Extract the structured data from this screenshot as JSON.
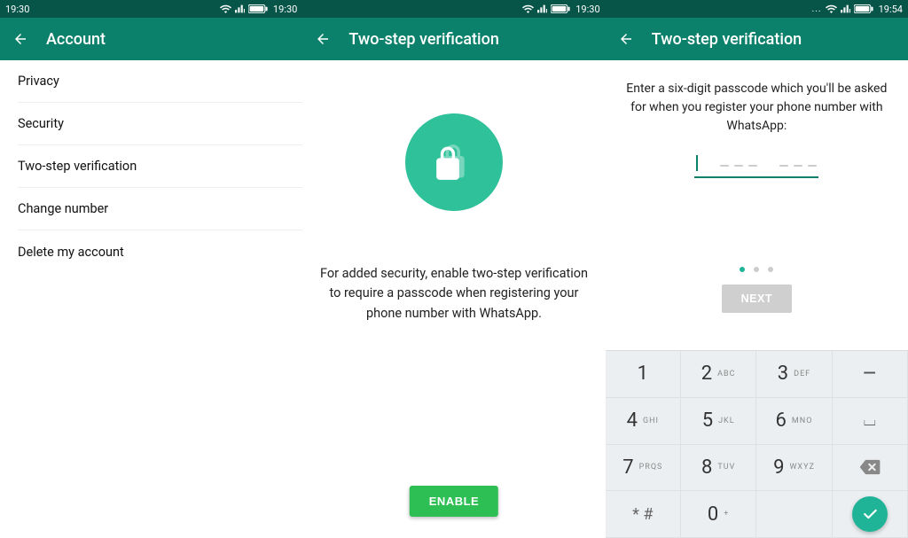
{
  "colors": {
    "primary": "#0b806a",
    "accent": "#2fc19a",
    "enable": "#2dbf54"
  },
  "status": {
    "s1": {
      "time_left": "19:30",
      "time_right": "19:30"
    },
    "s2": {
      "time_right": "19:30"
    },
    "s3": {
      "time_right": "19:54",
      "overflow": "..."
    }
  },
  "s1": {
    "title": "Account",
    "items": [
      {
        "label": "Privacy"
      },
      {
        "label": "Security"
      },
      {
        "label": "Two-step verification"
      },
      {
        "label": "Change number"
      },
      {
        "label": "Delete my account"
      }
    ]
  },
  "s2": {
    "title": "Two-step verification",
    "desc": "For added security, enable two-step verification to require a passcode when registering your phone number with WhatsApp.",
    "enable_label": "ENABLE"
  },
  "s3": {
    "title": "Two-step verification",
    "desc": "Enter a six-digit passcode which you'll be asked for when you register your phone number with WhatsApp:",
    "next_label": "NEXT",
    "page_dots": 3,
    "active_dot": 0,
    "keypad": [
      {
        "digit": "1",
        "sub": ""
      },
      {
        "digit": "2",
        "sub": "ABC"
      },
      {
        "digit": "3",
        "sub": "DEF"
      },
      {
        "digit": "4",
        "sub": "GHI"
      },
      {
        "digit": "5",
        "sub": "JKL"
      },
      {
        "digit": "6",
        "sub": "MNO"
      },
      {
        "digit": "7",
        "sub": "PRQS"
      },
      {
        "digit": "8",
        "sub": "TUV"
      },
      {
        "digit": "9",
        "sub": "WXYZ"
      },
      {
        "digit": "* #",
        "sub": ""
      },
      {
        "digit": "0",
        "sub": "+"
      }
    ],
    "minus_label": "–",
    "underscore_label": "⌴"
  }
}
